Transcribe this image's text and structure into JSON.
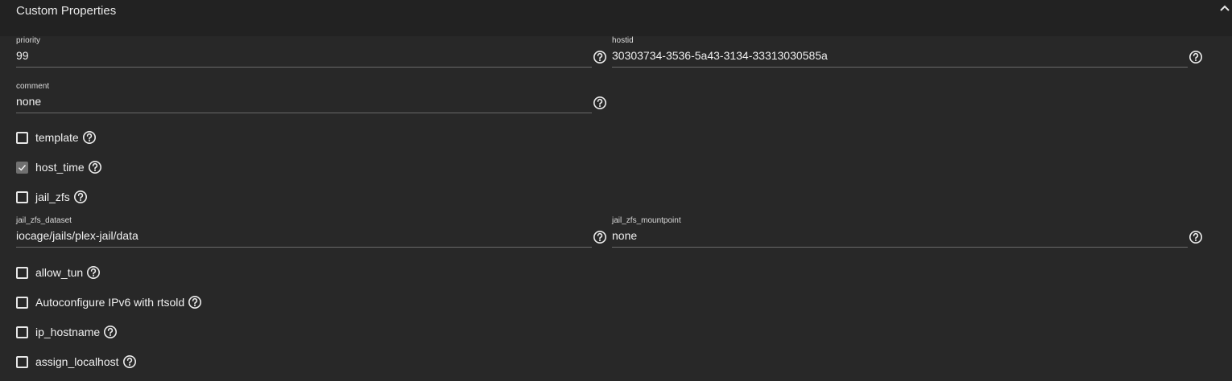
{
  "panel": {
    "title": "Custom Properties",
    "collapse_icon": "chevron-up-icon"
  },
  "fields": {
    "priority": {
      "label": "priority",
      "value": "99"
    },
    "hostid": {
      "label": "hostid",
      "value": "30303734-3536-5a43-3134-33313030585a"
    },
    "comment": {
      "label": "comment",
      "value": "none"
    },
    "jail_zfs_dataset": {
      "label": "jail_zfs_dataset",
      "value": "iocage/jails/plex-jail/data"
    },
    "jail_zfs_mountpoint": {
      "label": "jail_zfs_mountpoint",
      "value": "none"
    }
  },
  "checkboxes": {
    "template": {
      "label": "template",
      "checked": false
    },
    "host_time": {
      "label": "host_time",
      "checked": true
    },
    "jail_zfs": {
      "label": "jail_zfs",
      "checked": false
    },
    "allow_tun": {
      "label": "allow_tun",
      "checked": false
    },
    "autoconfigure_ipv6": {
      "label": "Autoconfigure IPv6 with rtsold",
      "checked": false
    },
    "ip_hostname": {
      "label": "ip_hostname",
      "checked": false
    },
    "assign_localhost": {
      "label": "assign_localhost",
      "checked": false
    }
  },
  "icons": {
    "help": "help-circle-icon",
    "check": "checkmark-icon"
  },
  "colors": {
    "background": "#282828",
    "header": "#222222",
    "text": "#e8e8e8",
    "underline": "#6a6a6a",
    "checked_box": "#707070"
  }
}
